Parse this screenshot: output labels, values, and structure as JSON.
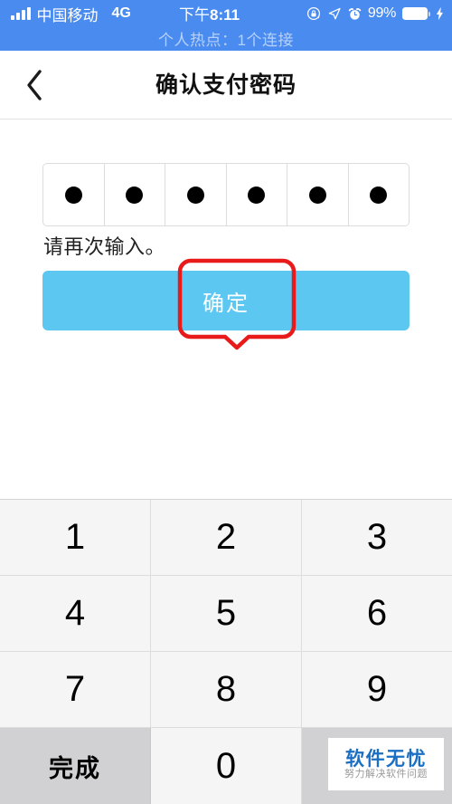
{
  "colors": {
    "status_bar_blue": "#4a8bf0",
    "hotspot_text": "#ffffff99",
    "confirm_button": "#5cc8f2",
    "annotation_red": "#e81a1a",
    "key_bg": "#f5f5f5",
    "key_fn_bg": "#d1d1d3",
    "watermark_blue": "#1a6fc4"
  },
  "status_bar": {
    "signal_icon": "signal-bars-icon",
    "carrier": "中国移动",
    "network": "4G",
    "time_prefix": "下午",
    "time": "8:11",
    "rotation_lock_icon": "rotation-lock-icon",
    "location_icon": "location-arrow-icon",
    "alarm_icon": "alarm-clock-icon",
    "battery_percent": "99%",
    "battery_icon": "battery-icon",
    "charging_icon": "lightning-bolt-icon",
    "hotspot_banner": "个人热点：1个连接"
  },
  "navbar": {
    "back_icon": "chevron-left-icon",
    "title": "确认支付密码"
  },
  "pin": {
    "length": 6,
    "filled": 6,
    "dot_icon": "filled-dot-icon"
  },
  "content": {
    "hint": "请再次输入。",
    "confirm_label": "确定"
  },
  "annotation": {
    "shape": "rounded-callout-with-tail",
    "color": "#e81a1a",
    "target": "确定"
  },
  "keyboard": {
    "rows": [
      [
        {
          "label": "1",
          "type": "digit"
        },
        {
          "label": "2",
          "type": "digit"
        },
        {
          "label": "3",
          "type": "digit"
        }
      ],
      [
        {
          "label": "4",
          "type": "digit"
        },
        {
          "label": "5",
          "type": "digit"
        },
        {
          "label": "6",
          "type": "digit"
        }
      ],
      [
        {
          "label": "7",
          "type": "digit"
        },
        {
          "label": "8",
          "type": "digit"
        },
        {
          "label": "9",
          "type": "digit"
        }
      ],
      [
        {
          "label": "完成",
          "type": "fn"
        },
        {
          "label": "0",
          "type": "digit"
        },
        {
          "label": "",
          "type": "blank"
        }
      ]
    ]
  },
  "watermark": {
    "main": "软件无忧",
    "sub": "努力解决软件问题"
  }
}
